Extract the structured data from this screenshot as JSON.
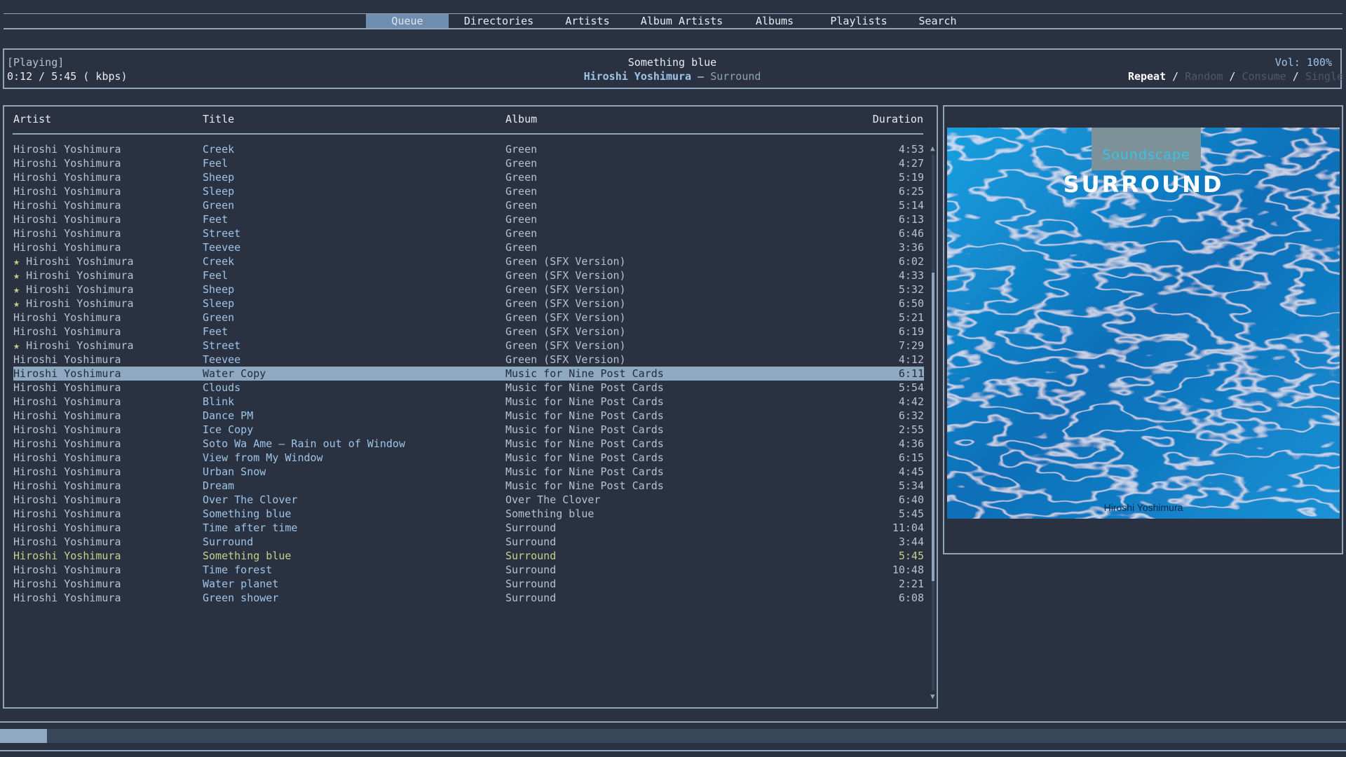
{
  "tabs": [
    {
      "label": "Queue",
      "active": true
    },
    {
      "label": "Directories"
    },
    {
      "label": "Artists"
    },
    {
      "label": "Album Artists"
    },
    {
      "label": "Albums"
    },
    {
      "label": "Playlists"
    },
    {
      "label": "Search"
    }
  ],
  "header": {
    "state": "[Playing]",
    "time": "0:12 / 5:45 ( kbps)",
    "song_title": "Something blue",
    "song_artist": "Hiroshi Yoshimura",
    "separator": " – ",
    "song_album": "Surround",
    "volume": "Vol: 100%",
    "modes": [
      {
        "label": "Repeat",
        "on": true
      },
      {
        "label": "Random",
        "on": false
      },
      {
        "label": "Consume",
        "on": false
      },
      {
        "label": "Single",
        "on": false
      }
    ],
    "mode_sep": " / "
  },
  "queue": {
    "columns": {
      "artist": "Artist",
      "title": "Title",
      "album": "Album",
      "duration": "Duration"
    },
    "rows": [
      {
        "artist": "Hiroshi Yoshimura",
        "title": "Creek",
        "album": "Green",
        "duration": "4:53"
      },
      {
        "artist": "Hiroshi Yoshimura",
        "title": "Feel",
        "album": "Green",
        "duration": "4:27"
      },
      {
        "artist": "Hiroshi Yoshimura",
        "title": "Sheep",
        "album": "Green",
        "duration": "5:19"
      },
      {
        "artist": "Hiroshi Yoshimura",
        "title": "Sleep",
        "album": "Green",
        "duration": "6:25"
      },
      {
        "artist": "Hiroshi Yoshimura",
        "title": "Green",
        "album": "Green",
        "duration": "5:14"
      },
      {
        "artist": "Hiroshi Yoshimura",
        "title": "Feet",
        "album": "Green",
        "duration": "6:13"
      },
      {
        "artist": "Hiroshi Yoshimura",
        "title": "Street",
        "album": "Green",
        "duration": "6:46"
      },
      {
        "artist": "Hiroshi Yoshimura",
        "title": "Teevee",
        "album": "Green",
        "duration": "3:36"
      },
      {
        "artist": "Hiroshi Yoshimura",
        "title": "Creek",
        "album": "Green (SFX Version)",
        "duration": "6:02",
        "star": true
      },
      {
        "artist": "Hiroshi Yoshimura",
        "title": "Feel",
        "album": "Green (SFX Version)",
        "duration": "4:33",
        "star": true
      },
      {
        "artist": "Hiroshi Yoshimura",
        "title": "Sheep",
        "album": "Green (SFX Version)",
        "duration": "5:32",
        "star": true
      },
      {
        "artist": "Hiroshi Yoshimura",
        "title": "Sleep",
        "album": "Green (SFX Version)",
        "duration": "6:50",
        "star": true
      },
      {
        "artist": "Hiroshi Yoshimura",
        "title": "Green",
        "album": "Green (SFX Version)",
        "duration": "5:21"
      },
      {
        "artist": "Hiroshi Yoshimura",
        "title": "Feet",
        "album": "Green (SFX Version)",
        "duration": "6:19"
      },
      {
        "artist": "Hiroshi Yoshimura",
        "title": "Street",
        "album": "Green (SFX Version)",
        "duration": "7:29",
        "star": true
      },
      {
        "artist": "Hiroshi Yoshimura",
        "title": "Teevee",
        "album": "Green (SFX Version)",
        "duration": "4:12"
      },
      {
        "artist": "Hiroshi Yoshimura",
        "title": "Water Copy",
        "album": "Music for Nine Post Cards",
        "duration": "6:11",
        "selected": true
      },
      {
        "artist": "Hiroshi Yoshimura",
        "title": "Clouds",
        "album": "Music for Nine Post Cards",
        "duration": "5:54"
      },
      {
        "artist": "Hiroshi Yoshimura",
        "title": "Blink",
        "album": "Music for Nine Post Cards",
        "duration": "4:42"
      },
      {
        "artist": "Hiroshi Yoshimura",
        "title": "Dance PM",
        "album": "Music for Nine Post Cards",
        "duration": "6:32"
      },
      {
        "artist": "Hiroshi Yoshimura",
        "title": "Ice Copy",
        "album": "Music for Nine Post Cards",
        "duration": "2:55"
      },
      {
        "artist": "Hiroshi Yoshimura",
        "title": "Soto Wa Ame – Rain out of Window",
        "album": "Music for Nine Post Cards",
        "duration": "4:36"
      },
      {
        "artist": "Hiroshi Yoshimura",
        "title": "View from My Window",
        "album": "Music for Nine Post Cards",
        "duration": "6:15"
      },
      {
        "artist": "Hiroshi Yoshimura",
        "title": "Urban Snow",
        "album": "Music for Nine Post Cards",
        "duration": "4:45"
      },
      {
        "artist": "Hiroshi Yoshimura",
        "title": "Dream",
        "album": "Music for Nine Post Cards",
        "duration": "5:34"
      },
      {
        "artist": "Hiroshi Yoshimura",
        "title": "Over The Clover",
        "album": "Over The Clover",
        "duration": "6:40"
      },
      {
        "artist": "Hiroshi Yoshimura",
        "title": "Something blue",
        "album": "Something blue",
        "duration": "5:45"
      },
      {
        "artist": "Hiroshi Yoshimura",
        "title": "Time after time",
        "album": "Surround",
        "duration": "11:04"
      },
      {
        "artist": "Hiroshi Yoshimura",
        "title": "Surround",
        "album": "Surround",
        "duration": "3:44"
      },
      {
        "artist": "Hiroshi Yoshimura",
        "title": "Something blue",
        "album": "Surround",
        "duration": "5:45",
        "playing": true
      },
      {
        "artist": "Hiroshi Yoshimura",
        "title": "Time forest",
        "album": "Surround",
        "duration": "10:48"
      },
      {
        "artist": "Hiroshi Yoshimura",
        "title": "Water planet",
        "album": "Surround",
        "duration": "2:21"
      },
      {
        "artist": "Hiroshi Yoshimura",
        "title": "Green shower",
        "album": "Surround",
        "duration": "6:08"
      }
    ],
    "star_glyph": "★",
    "scroll_up_icon": "▲",
    "scroll_down_icon": "▼"
  },
  "album_art": {
    "label": "Soundscape",
    "title": "SURROUND",
    "artist": "Hiroshi Yoshimura"
  },
  "progress": {
    "fraction": 0.035
  },
  "colors": {
    "background": "#2a3140",
    "border": "#8fa4bb",
    "accent": "#6f8daf",
    "selected_row": "#8fa9c2",
    "playing_row": "#c8cf8a",
    "title_text": "#9ec5e8",
    "water": "#1e8fd4"
  }
}
